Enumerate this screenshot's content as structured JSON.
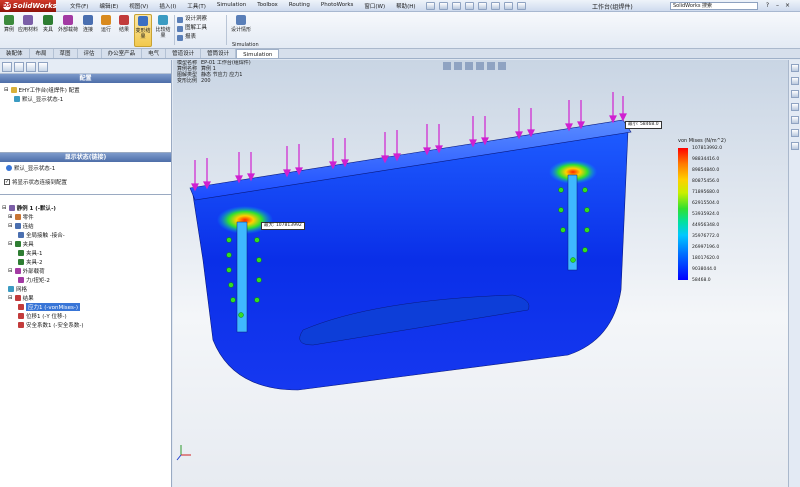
{
  "app": {
    "name": "SolidWorks",
    "doc_title": "工作台(组焊件)",
    "search_placeholder": "SolidWorks 搜索"
  },
  "menus": [
    "文件(F)",
    "编辑(E)",
    "视图(V)",
    "插入(I)",
    "工具(T)",
    "Simulation",
    "Toolbox",
    "Routing",
    "PhotoWorks",
    "窗口(W)",
    "帮助(H)"
  ],
  "ribbon": {
    "buttons": [
      {
        "label": "算例",
        "icon": "study-icon",
        "color": "#3c8a3c"
      },
      {
        "label": "应用材料",
        "icon": "material-icon",
        "color": "#7b5ea7"
      },
      {
        "label": "夹具",
        "icon": "fixture-icon",
        "color": "#2e7d32"
      },
      {
        "label": "外部载荷",
        "icon": "load-icon",
        "color": "#a33aa3"
      },
      {
        "label": "连接",
        "icon": "connection-icon",
        "color": "#4a6fb0"
      },
      {
        "label": "运行",
        "icon": "run-icon",
        "color": "#d98a1e"
      },
      {
        "label": "结果",
        "icon": "results-icon",
        "color": "#c23b3b"
      },
      {
        "label": "变形结果",
        "icon": "deform-icon",
        "color": "#3b6fc2",
        "active": true
      },
      {
        "label": "比较结果",
        "icon": "compare-icon",
        "color": "#3b9bc2"
      }
    ],
    "list1": [
      "设计洞察",
      "图解工具",
      "报表"
    ],
    "list2_label": "设计情形",
    "group_label": "Simulation"
  },
  "tabs": [
    "装配体",
    "布局",
    "草图",
    "评估",
    "办公室产品",
    "电气",
    "管道设计",
    "管筒设计",
    "Simulation"
  ],
  "active_tab": "Simulation",
  "panel": {
    "title": "配置",
    "config_items": [
      "EHY工作台(组焊件) 配置",
      "默认_显示状态-1"
    ],
    "display_title": "显示状态(链接)",
    "display_items": [
      "默认_显示状态-1"
    ],
    "checkbox_label": "将显示状态连接到配置",
    "tree": [
      {
        "label": "静例 1 (-默认-)",
        "level": 0,
        "icon": "#7b5ea7"
      },
      {
        "label": "零件",
        "level": 1,
        "icon": "#c87533"
      },
      {
        "label": "连结",
        "level": 1,
        "icon": "#4a6fb0"
      },
      {
        "label": "全局接触 -接合-",
        "level": 2,
        "icon": "#4a6fb0"
      },
      {
        "label": "夹具",
        "level": 1,
        "icon": "#2e7d32"
      },
      {
        "label": "夹具-1",
        "level": 2,
        "icon": "#2e7d32"
      },
      {
        "label": "夹具-2",
        "level": 2,
        "icon": "#2e7d32"
      },
      {
        "label": "外部载荷",
        "level": 1,
        "icon": "#a33aa3"
      },
      {
        "label": "力/扭矩-2",
        "level": 2,
        "icon": "#a33aa3"
      },
      {
        "label": "网格",
        "level": 1,
        "icon": "#3b9bc2"
      },
      {
        "label": "结果",
        "level": 1,
        "icon": "#c23b3b"
      },
      {
        "label": "应力1 (-vonMises-)",
        "level": 2,
        "icon": "#c23b3b",
        "selected": true
      },
      {
        "label": "位移1 (-Y 位移-)",
        "level": 2,
        "icon": "#c23b3b"
      },
      {
        "label": "安全系数1 (-安全系数-)",
        "level": 2,
        "icon": "#c23b3b"
      }
    ]
  },
  "viewport": {
    "info": [
      {
        "k": "模型名称",
        "v": "EP-01 工作台(组焊件)"
      },
      {
        "k": "算例名称",
        "v": "算例 1"
      },
      {
        "k": "图解类型",
        "v": "静态 节应力 应力1"
      },
      {
        "k": "变形比例",
        "v": "200"
      }
    ],
    "legend_title": "von Mises (N/m^2)",
    "legend_values": [
      "107813992.0",
      "98834416.0",
      "89854840.0",
      "80875456.0",
      "71895680.0",
      "62915504.0",
      "53935924.0",
      "44956348.0",
      "35976772.0",
      "26997196.0",
      "18017620.0",
      "9038044.0",
      "58468.0"
    ],
    "max_label": "最大: 107813992",
    "min_label": "最小: 58468.0"
  }
}
